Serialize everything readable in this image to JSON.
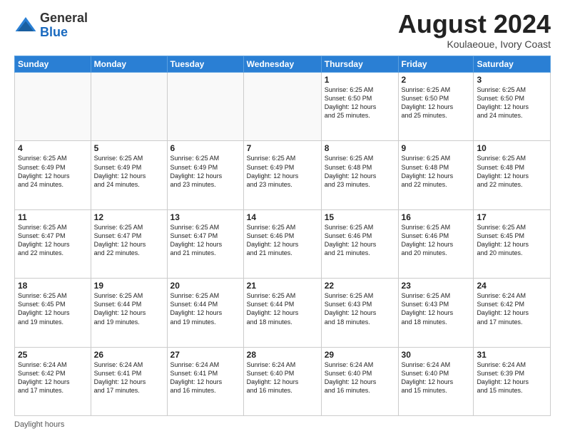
{
  "header": {
    "logo_general": "General",
    "logo_blue": "Blue",
    "month_year": "August 2024",
    "location": "Koulaeoue, Ivory Coast"
  },
  "days_of_week": [
    "Sunday",
    "Monday",
    "Tuesday",
    "Wednesday",
    "Thursday",
    "Friday",
    "Saturday"
  ],
  "weeks": [
    [
      {
        "day": "",
        "info": ""
      },
      {
        "day": "",
        "info": ""
      },
      {
        "day": "",
        "info": ""
      },
      {
        "day": "",
        "info": ""
      },
      {
        "day": "1",
        "info": "Sunrise: 6:25 AM\nSunset: 6:50 PM\nDaylight: 12 hours\nand 25 minutes."
      },
      {
        "day": "2",
        "info": "Sunrise: 6:25 AM\nSunset: 6:50 PM\nDaylight: 12 hours\nand 25 minutes."
      },
      {
        "day": "3",
        "info": "Sunrise: 6:25 AM\nSunset: 6:50 PM\nDaylight: 12 hours\nand 24 minutes."
      }
    ],
    [
      {
        "day": "4",
        "info": "Sunrise: 6:25 AM\nSunset: 6:49 PM\nDaylight: 12 hours\nand 24 minutes."
      },
      {
        "day": "5",
        "info": "Sunrise: 6:25 AM\nSunset: 6:49 PM\nDaylight: 12 hours\nand 24 minutes."
      },
      {
        "day": "6",
        "info": "Sunrise: 6:25 AM\nSunset: 6:49 PM\nDaylight: 12 hours\nand 23 minutes."
      },
      {
        "day": "7",
        "info": "Sunrise: 6:25 AM\nSunset: 6:49 PM\nDaylight: 12 hours\nand 23 minutes."
      },
      {
        "day": "8",
        "info": "Sunrise: 6:25 AM\nSunset: 6:48 PM\nDaylight: 12 hours\nand 23 minutes."
      },
      {
        "day": "9",
        "info": "Sunrise: 6:25 AM\nSunset: 6:48 PM\nDaylight: 12 hours\nand 22 minutes."
      },
      {
        "day": "10",
        "info": "Sunrise: 6:25 AM\nSunset: 6:48 PM\nDaylight: 12 hours\nand 22 minutes."
      }
    ],
    [
      {
        "day": "11",
        "info": "Sunrise: 6:25 AM\nSunset: 6:47 PM\nDaylight: 12 hours\nand 22 minutes."
      },
      {
        "day": "12",
        "info": "Sunrise: 6:25 AM\nSunset: 6:47 PM\nDaylight: 12 hours\nand 22 minutes."
      },
      {
        "day": "13",
        "info": "Sunrise: 6:25 AM\nSunset: 6:47 PM\nDaylight: 12 hours\nand 21 minutes."
      },
      {
        "day": "14",
        "info": "Sunrise: 6:25 AM\nSunset: 6:46 PM\nDaylight: 12 hours\nand 21 minutes."
      },
      {
        "day": "15",
        "info": "Sunrise: 6:25 AM\nSunset: 6:46 PM\nDaylight: 12 hours\nand 21 minutes."
      },
      {
        "day": "16",
        "info": "Sunrise: 6:25 AM\nSunset: 6:46 PM\nDaylight: 12 hours\nand 20 minutes."
      },
      {
        "day": "17",
        "info": "Sunrise: 6:25 AM\nSunset: 6:45 PM\nDaylight: 12 hours\nand 20 minutes."
      }
    ],
    [
      {
        "day": "18",
        "info": "Sunrise: 6:25 AM\nSunset: 6:45 PM\nDaylight: 12 hours\nand 19 minutes."
      },
      {
        "day": "19",
        "info": "Sunrise: 6:25 AM\nSunset: 6:44 PM\nDaylight: 12 hours\nand 19 minutes."
      },
      {
        "day": "20",
        "info": "Sunrise: 6:25 AM\nSunset: 6:44 PM\nDaylight: 12 hours\nand 19 minutes."
      },
      {
        "day": "21",
        "info": "Sunrise: 6:25 AM\nSunset: 6:44 PM\nDaylight: 12 hours\nand 18 minutes."
      },
      {
        "day": "22",
        "info": "Sunrise: 6:25 AM\nSunset: 6:43 PM\nDaylight: 12 hours\nand 18 minutes."
      },
      {
        "day": "23",
        "info": "Sunrise: 6:25 AM\nSunset: 6:43 PM\nDaylight: 12 hours\nand 18 minutes."
      },
      {
        "day": "24",
        "info": "Sunrise: 6:24 AM\nSunset: 6:42 PM\nDaylight: 12 hours\nand 17 minutes."
      }
    ],
    [
      {
        "day": "25",
        "info": "Sunrise: 6:24 AM\nSunset: 6:42 PM\nDaylight: 12 hours\nand 17 minutes."
      },
      {
        "day": "26",
        "info": "Sunrise: 6:24 AM\nSunset: 6:41 PM\nDaylight: 12 hours\nand 17 minutes."
      },
      {
        "day": "27",
        "info": "Sunrise: 6:24 AM\nSunset: 6:41 PM\nDaylight: 12 hours\nand 16 minutes."
      },
      {
        "day": "28",
        "info": "Sunrise: 6:24 AM\nSunset: 6:40 PM\nDaylight: 12 hours\nand 16 minutes."
      },
      {
        "day": "29",
        "info": "Sunrise: 6:24 AM\nSunset: 6:40 PM\nDaylight: 12 hours\nand 16 minutes."
      },
      {
        "day": "30",
        "info": "Sunrise: 6:24 AM\nSunset: 6:40 PM\nDaylight: 12 hours\nand 15 minutes."
      },
      {
        "day": "31",
        "info": "Sunrise: 6:24 AM\nSunset: 6:39 PM\nDaylight: 12 hours\nand 15 minutes."
      }
    ]
  ],
  "footer": {
    "daylight_hours_label": "Daylight hours"
  }
}
